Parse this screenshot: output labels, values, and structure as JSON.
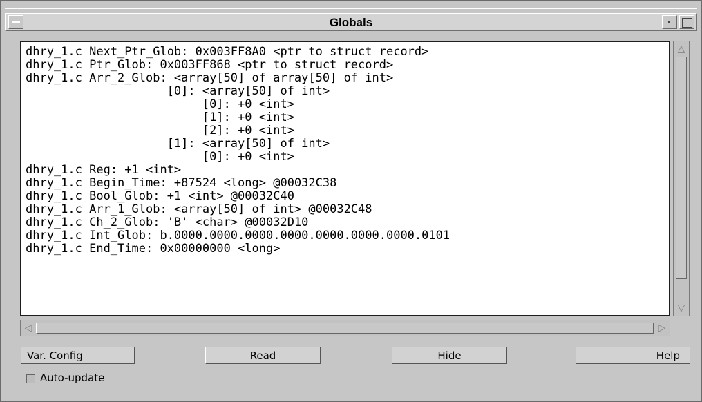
{
  "window": {
    "title": "Globals"
  },
  "globals": {
    "lines": [
      "dhry_1.c Next_Ptr_Glob: 0x003FF8A0 <ptr to struct record>",
      "dhry_1.c Ptr_Glob: 0x003FF868 <ptr to struct record>",
      "dhry_1.c Arr_2_Glob: <array[50] of array[50] of int>",
      "                    [0]: <array[50] of int>",
      "                         [0]: +0 <int>",
      "                         [1]: +0 <int>",
      "                         [2]: +0 <int>",
      "                    [1]: <array[50] of int>",
      "                         [0]: +0 <int>",
      "dhry_1.c Reg: +1 <int>",
      "dhry_1.c Begin_Time: +87524 <long> @00032C38",
      "dhry_1.c Bool_Glob: +1 <int> @00032C40",
      "dhry_1.c Arr_1_Glob: <array[50] of int> @00032C48",
      "dhry_1.c Ch_2_Glob: 'B' <char> @00032D10",
      "dhry_1.c Int_Glob: b.0000.0000.0000.0000.0000.0000.0000.0101",
      "dhry_1.c End_Time: 0x00000000 <long>"
    ]
  },
  "buttons": {
    "var_config": "Var. Config",
    "read": "Read",
    "hide": "Hide",
    "help": "Help"
  },
  "auto_update": {
    "label": "Auto-update",
    "checked": false
  },
  "icons": {
    "scroll_up": "up-arrow-icon",
    "scroll_down": "down-arrow-icon",
    "scroll_left": "left-arrow-icon",
    "scroll_right": "right-arrow-icon"
  }
}
